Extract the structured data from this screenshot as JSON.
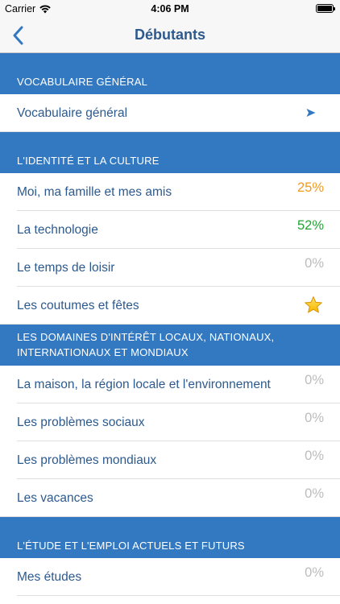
{
  "status_bar": {
    "carrier": "Carrier",
    "time": "4:06 PM"
  },
  "nav": {
    "title": "Débutants",
    "back_icon": "chevron-left-icon"
  },
  "colors": {
    "accent": "#3279c2",
    "text": "#2d5a8e",
    "orange": "#f29a1e",
    "green": "#25a336",
    "muted": "#bcbcbc"
  },
  "sections": [
    {
      "title": "VOCABULAIRE GÉNÉRAL",
      "items": [
        {
          "label": "Vocabulaire général",
          "icon": "arrow-icon"
        }
      ]
    },
    {
      "title": "L'IDENTITÉ ET LA CULTURE",
      "items": [
        {
          "label": "Moi, ma famille et mes amis",
          "value": "25%"
        },
        {
          "label": "La technologie",
          "value": "52%"
        },
        {
          "label": "Le temps de loisir",
          "value": "0%"
        },
        {
          "label": "Les coutumes et fêtes",
          "icon": "star-icon"
        }
      ]
    },
    {
      "title": "LES DOMAINES D'INTÉRÊT LOCAUX, NATIONAUX, INTERNATIONAUX ET MONDIAUX",
      "items": [
        {
          "label": "La maison, la région locale et l'environnement",
          "value": "0%"
        },
        {
          "label": "Les problèmes sociaux",
          "value": "0%"
        },
        {
          "label": "Les problèmes mondiaux",
          "value": "0%"
        },
        {
          "label": "Les vacances",
          "value": "0%"
        }
      ]
    },
    {
      "title": "L'ÉTUDE ET L'EMPLOI ACTUELS ET FUTURS",
      "items": [
        {
          "label": "Mes études",
          "value": "0%"
        }
      ]
    }
  ]
}
